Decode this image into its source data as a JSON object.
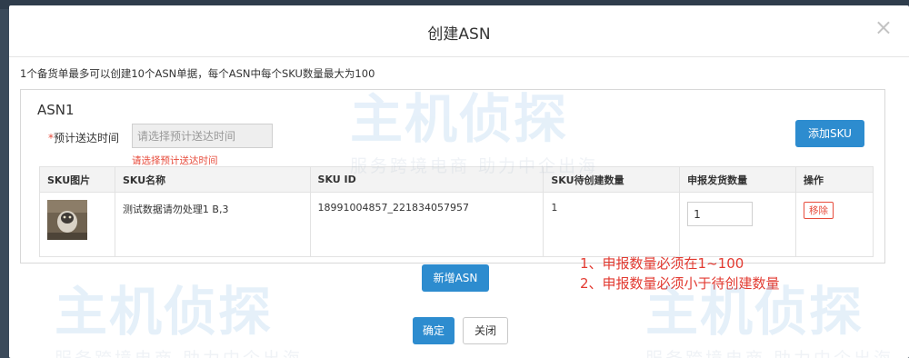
{
  "modal": {
    "title": "创建ASN",
    "close_symbol": "×",
    "info": "1个备货单最多可以创建10个ASN单据，每个ASN中每个SKU数量最大为100"
  },
  "asn": {
    "title": "ASN1",
    "delivery_label": "*预计送达时间",
    "delivery_required_mark": "*",
    "delivery_label_text": "预计送达时间",
    "delivery_placeholder": "请选择预计送达时间",
    "delivery_error": "请选择预计送达时间",
    "add_sku_label": "添加SKU"
  },
  "table": {
    "headers": [
      "SKU图片",
      "SKU名称",
      "SKU ID",
      "SKU待创建数量",
      "申报发货数量",
      "操作"
    ],
    "rows": [
      {
        "name": "测试数据请勿处理1 B,3",
        "sku_id": "18991004857_221834057957",
        "pending_qty": "1",
        "declare_qty": "1",
        "action": "移除"
      }
    ]
  },
  "notes": [
    "1、申报数量必须在1~100",
    "2、申报数量必须小于待创建数量"
  ],
  "buttons": {
    "new_asn": "新增ASN",
    "confirm": "确定",
    "close": "关闭"
  },
  "watermark": {
    "logo_text": "主机侦探",
    "tagline": "服务跨境电商 助力中企出海"
  },
  "colors": {
    "primary": "#2d8ccf",
    "error": "#e74c3c",
    "note": "#e23a31"
  }
}
